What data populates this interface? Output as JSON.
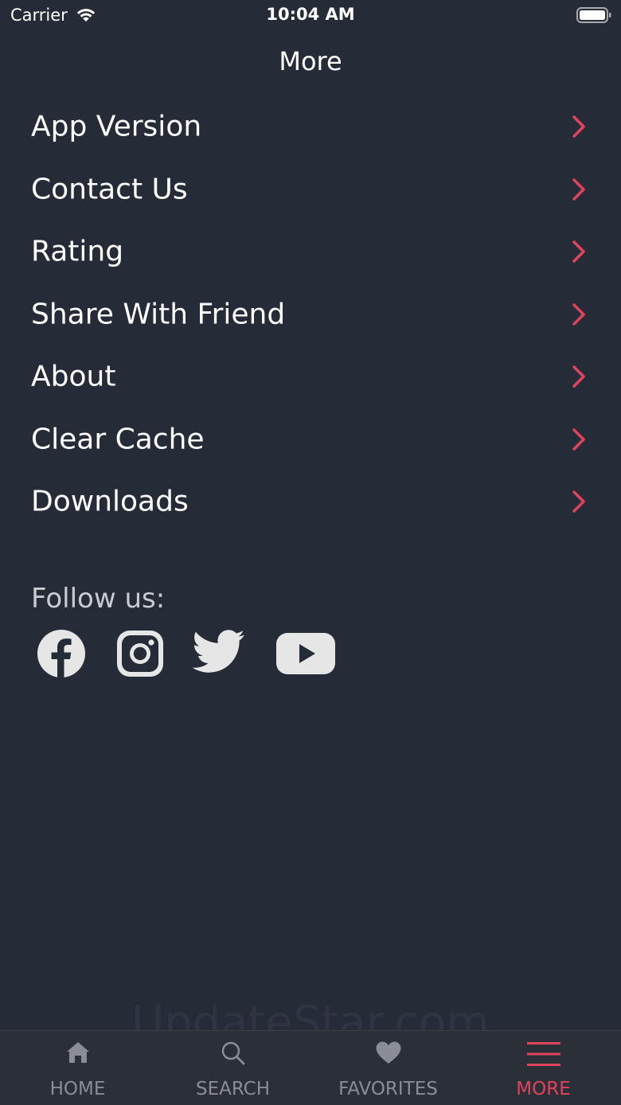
{
  "status_bar": {
    "carrier": "Carrier",
    "time": "10:04 AM"
  },
  "header": {
    "title": "More"
  },
  "menu": {
    "items": [
      {
        "label": "App Version"
      },
      {
        "label": "Contact Us"
      },
      {
        "label": "Rating"
      },
      {
        "label": "Share With Friend"
      },
      {
        "label": "About"
      },
      {
        "label": "Clear Cache"
      },
      {
        "label": "Downloads"
      }
    ]
  },
  "social": {
    "label": "Follow us:",
    "links": [
      {
        "icon": "facebook-icon"
      },
      {
        "icon": "instagram-icon"
      },
      {
        "icon": "twitter-icon"
      },
      {
        "icon": "youtube-icon"
      }
    ]
  },
  "watermark": "UpdateStar.com",
  "tab_bar": {
    "tabs": [
      {
        "label": "HOME",
        "icon": "home-icon"
      },
      {
        "label": "SEARCH",
        "icon": "search-icon"
      },
      {
        "label": "FAVORITES",
        "icon": "heart-icon"
      },
      {
        "label": "MORE",
        "icon": "hamburger-menu-icon"
      }
    ],
    "active": "MORE"
  },
  "colors": {
    "background": "#262b38",
    "accent": "#e0435c",
    "tab_bar_bg": "#2b2f38",
    "inactive": "#8a8d93",
    "social_icon": "#e6e6e6"
  }
}
